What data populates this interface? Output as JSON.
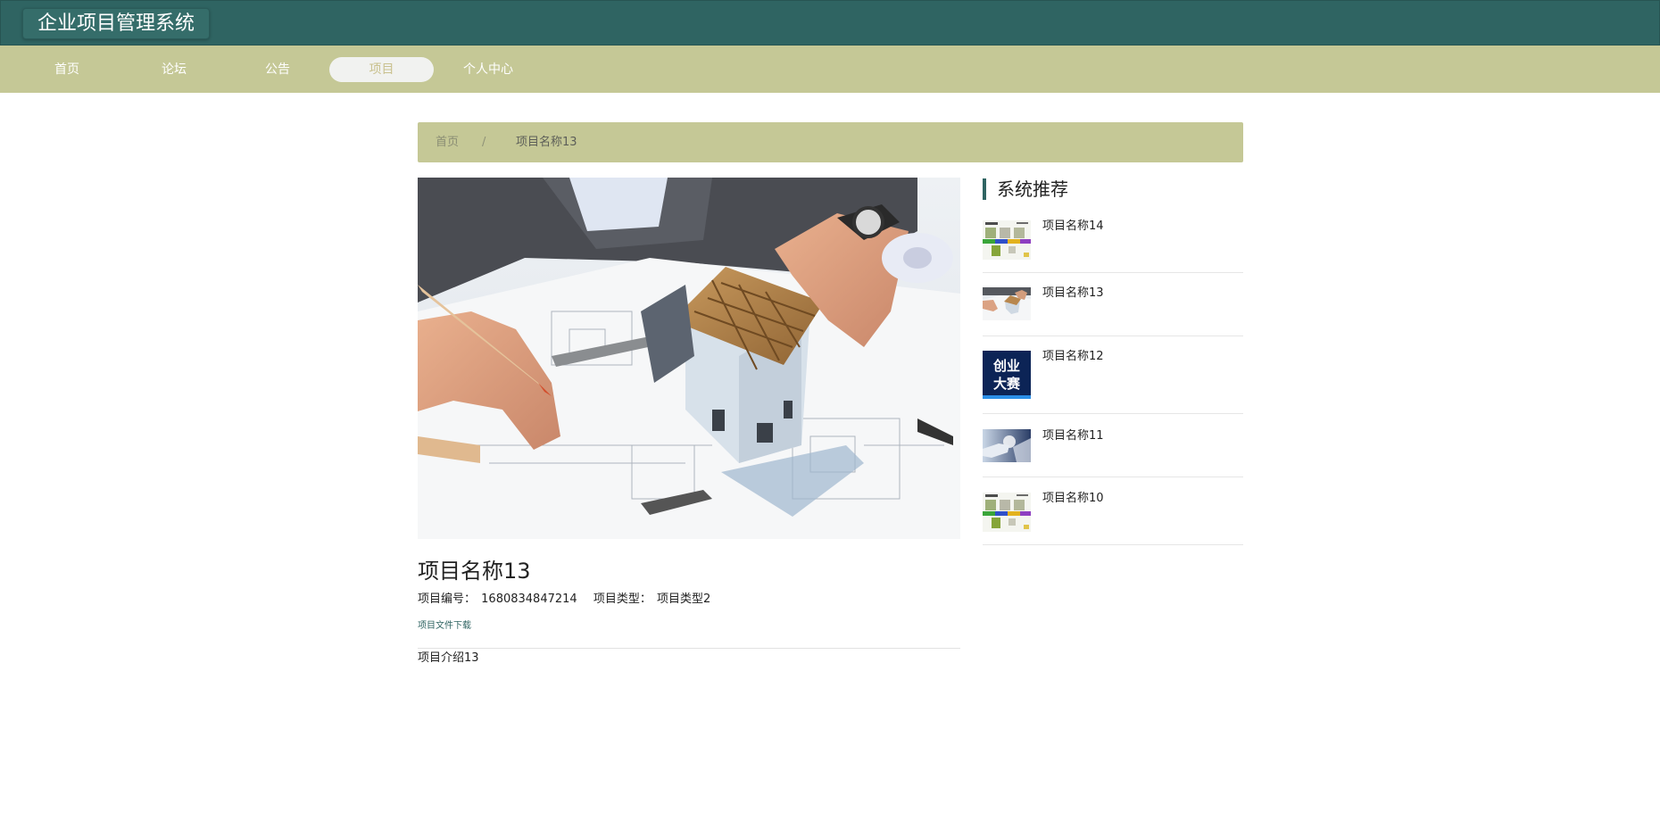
{
  "header": {
    "title": "企业项目管理系统"
  },
  "nav": {
    "items": [
      {
        "label": "首页"
      },
      {
        "label": "论坛"
      },
      {
        "label": "公告"
      },
      {
        "label": "项目",
        "active": true
      },
      {
        "label": "个人中心"
      }
    ]
  },
  "breadcrumb": {
    "home": "首页",
    "separator": "/",
    "current": "项目名称13"
  },
  "project": {
    "name": "项目名称13",
    "number_label": "项目编号：",
    "number": "1680834847214",
    "type_label": "项目类型：",
    "type": "项目类型2",
    "download_label": "项目文件下载",
    "intro": "项目介绍13"
  },
  "recommend": {
    "title": "系统推荐",
    "items": [
      {
        "name": "项目名称14",
        "thumb": "chart-thumb-icon"
      },
      {
        "name": "项目名称13",
        "thumb": "house-model-thumb-icon"
      },
      {
        "name": "项目名称12",
        "thumb": "competition-poster-icon",
        "poster_text": [
          "创业",
          "大赛"
        ]
      },
      {
        "name": "项目名称11",
        "thumb": "tech-hand-thumb-icon"
      },
      {
        "name": "项目名称10",
        "thumb": "chart-thumb-icon"
      }
    ]
  },
  "colors": {
    "header_bg": "#2f6462",
    "nav_bg": "#c5c896",
    "nav_active_bg": "#f1f2f0",
    "nav_active_text": "#c9c18e",
    "accent": "#2f6462"
  }
}
